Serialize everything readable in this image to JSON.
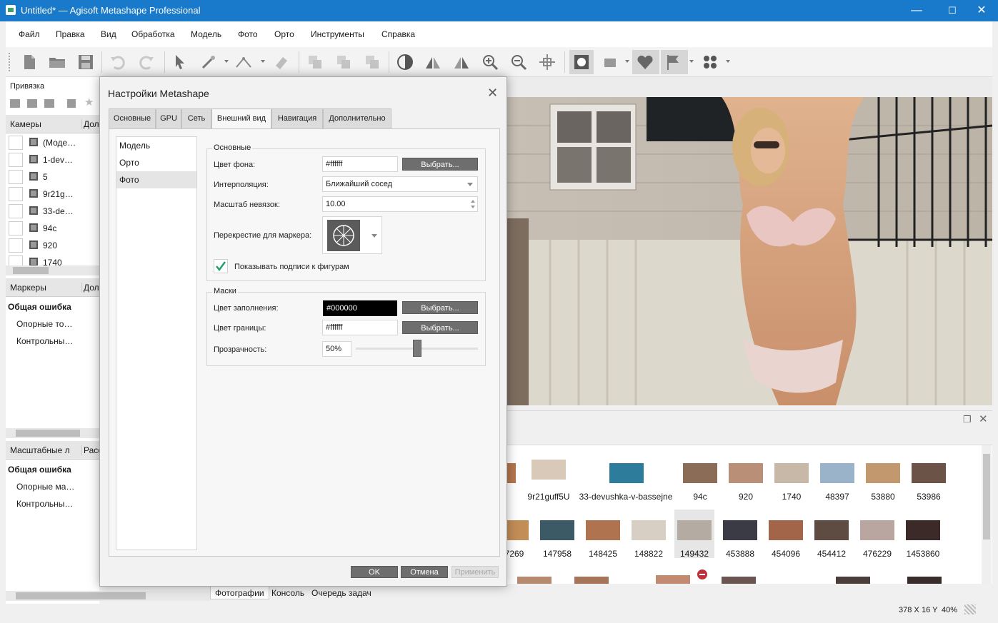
{
  "window": {
    "title": "Untitled* — Agisoft Metashape Professional",
    "minimize": "—",
    "maximize": "☐",
    "close": "✕"
  },
  "menu": [
    "Файл",
    "Правка",
    "Вид",
    "Обработка",
    "Модель",
    "Фото",
    "Орто",
    "Инструменты",
    "Справка"
  ],
  "left_panel": {
    "snap_label": "Привязка",
    "cameras_header": "Камеры",
    "cameras_header2": "Дол",
    "cameras": [
      "(Моде…",
      "1-dev…",
      "5",
      "9r21g…",
      "33-de…",
      "94c",
      "920",
      "1740"
    ],
    "markers_header": "Маркеры",
    "markers_header2": "Дол",
    "markers_group": "Общая ошибка",
    "markers_items": [
      "Опорные то…",
      "Контрольны…"
    ],
    "scales_header": "Масштабные л",
    "scales_header2": "Расс",
    "scales_group": "Общая ошибка",
    "scales_items": [
      "Опорные ма…",
      "Контрольны…"
    ]
  },
  "dialog": {
    "title": "Настройки Metashape",
    "close": "✕",
    "tabs": [
      "Основные",
      "GPU",
      "Сеть",
      "Внешний вид",
      "Навигация",
      "Дополнительно"
    ],
    "active_tab": "Внешний вид",
    "side": [
      "Модель",
      "Орто",
      "Фото"
    ],
    "side_selected": "Фото",
    "main_group": "Основные",
    "bg_color_label": "Цвет фона:",
    "bg_color_value": "#ffffff",
    "choose": "Выбрать...",
    "interp_label": "Интерполяция:",
    "interp_value": "Ближайший сосед",
    "residual_label": "Масштаб невязок:",
    "residual_value": "10.00",
    "crosshair_label": "Перекрестие для маркера:",
    "show_labels": "Показывать подписи к фигурам",
    "masks_group": "Маски",
    "fill_label": "Цвет заполнения:",
    "fill_value": "#000000",
    "border_label": "Цвет границы:",
    "border_value": "#ffffff",
    "opacity_label": "Прозрачность:",
    "opacity_value": "50%",
    "opacity_level": 0.5,
    "ok": "OK",
    "cancel": "Отмена",
    "apply": "Применить"
  },
  "photos": {
    "row1": [
      "9r21guff5U",
      "33-devushka-v-bassejne",
      "94c",
      "920",
      "1740",
      "48397",
      "53880",
      "53986"
    ],
    "row2": [
      "7269",
      "147958",
      "148425",
      "148822",
      "149432",
      "453888",
      "454096",
      "454412",
      "476229",
      "1453860"
    ]
  },
  "bottom_tabs": [
    "Фотографии",
    "Консоль",
    "Очередь задач"
  ],
  "status": {
    "x": "378 X",
    "y": "16 Y",
    "zoom": "40%"
  },
  "colors": {
    "titlebar": "#1979ca",
    "accent": "#6e6e6e"
  }
}
